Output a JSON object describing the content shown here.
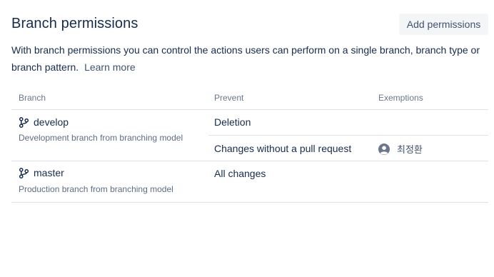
{
  "header": {
    "title": "Branch permissions",
    "add_button": "Add permissions"
  },
  "description": {
    "text": "With branch permissions you can control the actions users can perform on a single branch, branch type or branch pattern.",
    "learn_more": "Learn more"
  },
  "table": {
    "columns": [
      "Branch",
      "Prevent",
      "Exemptions"
    ],
    "rows": [
      {
        "branch": "develop",
        "subtitle": "Development branch from branching model",
        "restrictions": [
          {
            "prevent": "Deletion",
            "exemption": ""
          },
          {
            "prevent": "Changes without a pull request",
            "exemption": "최정환"
          }
        ]
      },
      {
        "branch": "master",
        "subtitle": "Production branch from branching model",
        "restrictions": [
          {
            "prevent": "All changes",
            "exemption": ""
          }
        ]
      }
    ]
  },
  "colors": {
    "text": "#172b4d",
    "muted": "#6b778c",
    "button_bg": "#f4f5f7",
    "border": "#dfe1e6"
  },
  "icons": {
    "branch": "branch-icon",
    "avatar": "user-avatar-icon"
  }
}
